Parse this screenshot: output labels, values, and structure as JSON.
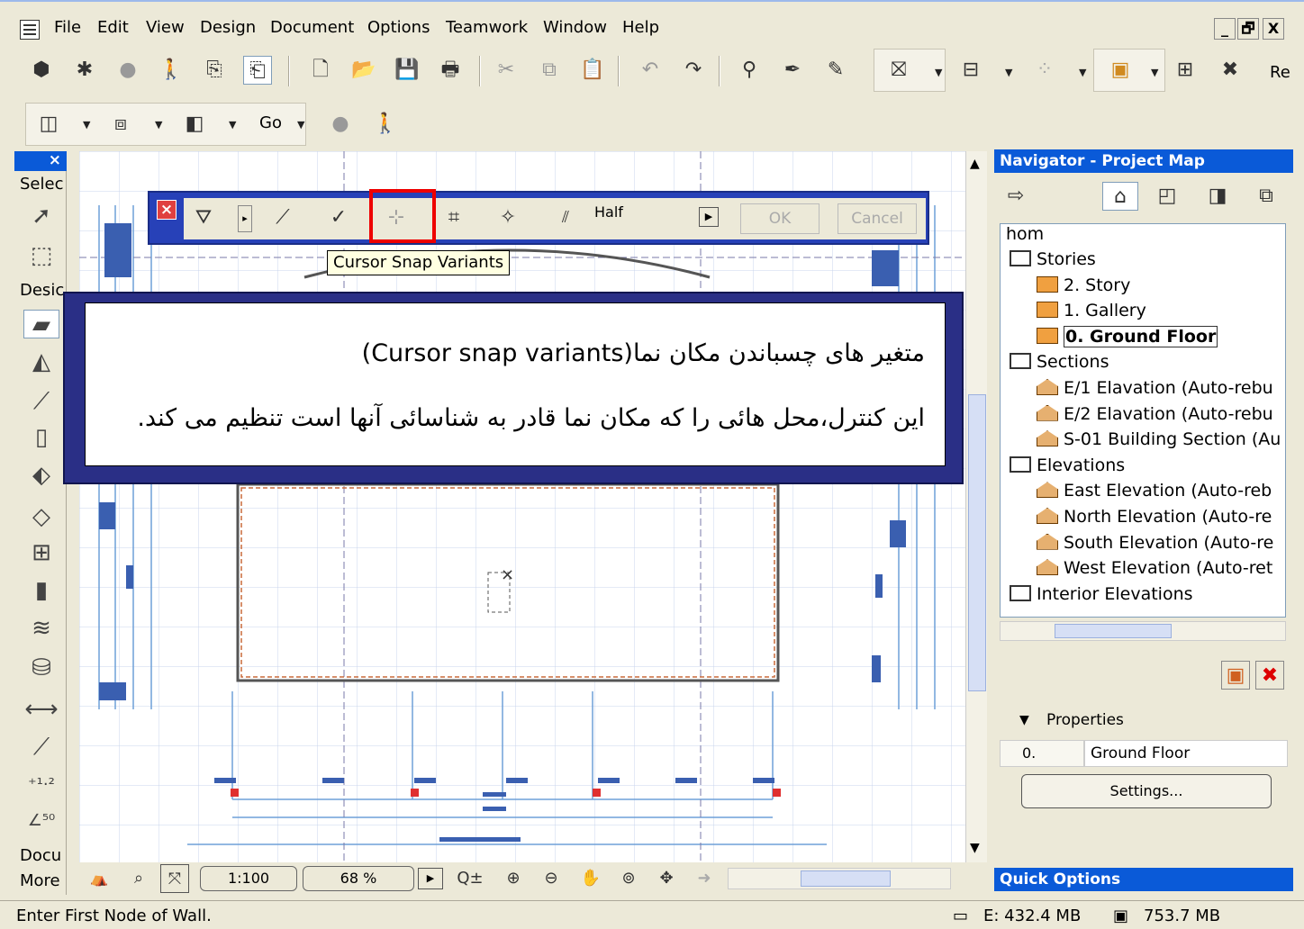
{
  "menu": {
    "items": [
      "File",
      "Edit",
      "View",
      "Design",
      "Document",
      "Options",
      "Teamwork",
      "Window",
      "Help"
    ],
    "window_buttons": [
      "_",
      "🗗",
      "X"
    ]
  },
  "toolbar": {
    "go_label": "Go",
    "re_label": "Re"
  },
  "toolbox": {
    "close": "×",
    "select_label": "Selec",
    "design_label": "Desic",
    "docu_label": "Docu",
    "more_label": "More"
  },
  "infobar": {
    "half_label": "Half",
    "ok_label": "OK",
    "cancel_label": "Cancel",
    "tooltip": "Cursor Snap Variants"
  },
  "callout": {
    "line1": "متغیر های چسباندن مکان نما(Cursor snap variants)",
    "line2": "این کنترل،محل هائی را که مکان نما قادر به شناسائی آنها است تنظیم می کند."
  },
  "bottombar": {
    "scale": "1:100",
    "zoom": "68 %"
  },
  "navigator": {
    "title": "Navigator - Project Map",
    "root": "hom",
    "items": [
      {
        "label": "Stories",
        "level": 0,
        "icon": "box"
      },
      {
        "label": "2. Story",
        "level": 1,
        "icon": "folder"
      },
      {
        "label": "1. Gallery",
        "level": 1,
        "icon": "folder"
      },
      {
        "label": "0. Ground Floor",
        "level": 1,
        "icon": "folder",
        "selected": true
      },
      {
        "label": "Sections",
        "level": 0,
        "icon": "box"
      },
      {
        "label": "E/1 Elavation (Auto-rebu",
        "level": 1,
        "icon": "house"
      },
      {
        "label": "E/2 Elavation (Auto-rebu",
        "level": 1,
        "icon": "house"
      },
      {
        "label": "S-01 Building Section (Au",
        "level": 1,
        "icon": "house"
      },
      {
        "label": "Elevations",
        "level": 0,
        "icon": "box"
      },
      {
        "label": "East Elevation (Auto-reb",
        "level": 1,
        "icon": "house"
      },
      {
        "label": "North Elevation (Auto-re",
        "level": 1,
        "icon": "house"
      },
      {
        "label": "South Elevation (Auto-re",
        "level": 1,
        "icon": "house"
      },
      {
        "label": "West Elevation (Auto-ret",
        "level": 1,
        "icon": "house"
      },
      {
        "label": "Interior Elevations",
        "level": 0,
        "icon": "box"
      }
    ],
    "properties_label": "Properties",
    "prop_id": "0.",
    "prop_name": "Ground Floor",
    "settings_label": "Settings..."
  },
  "quick_options": "Quick Options",
  "status": {
    "message": "Enter First Node of Wall.",
    "mem1": "E: 432.4 MB",
    "mem2": "753.7 MB"
  }
}
